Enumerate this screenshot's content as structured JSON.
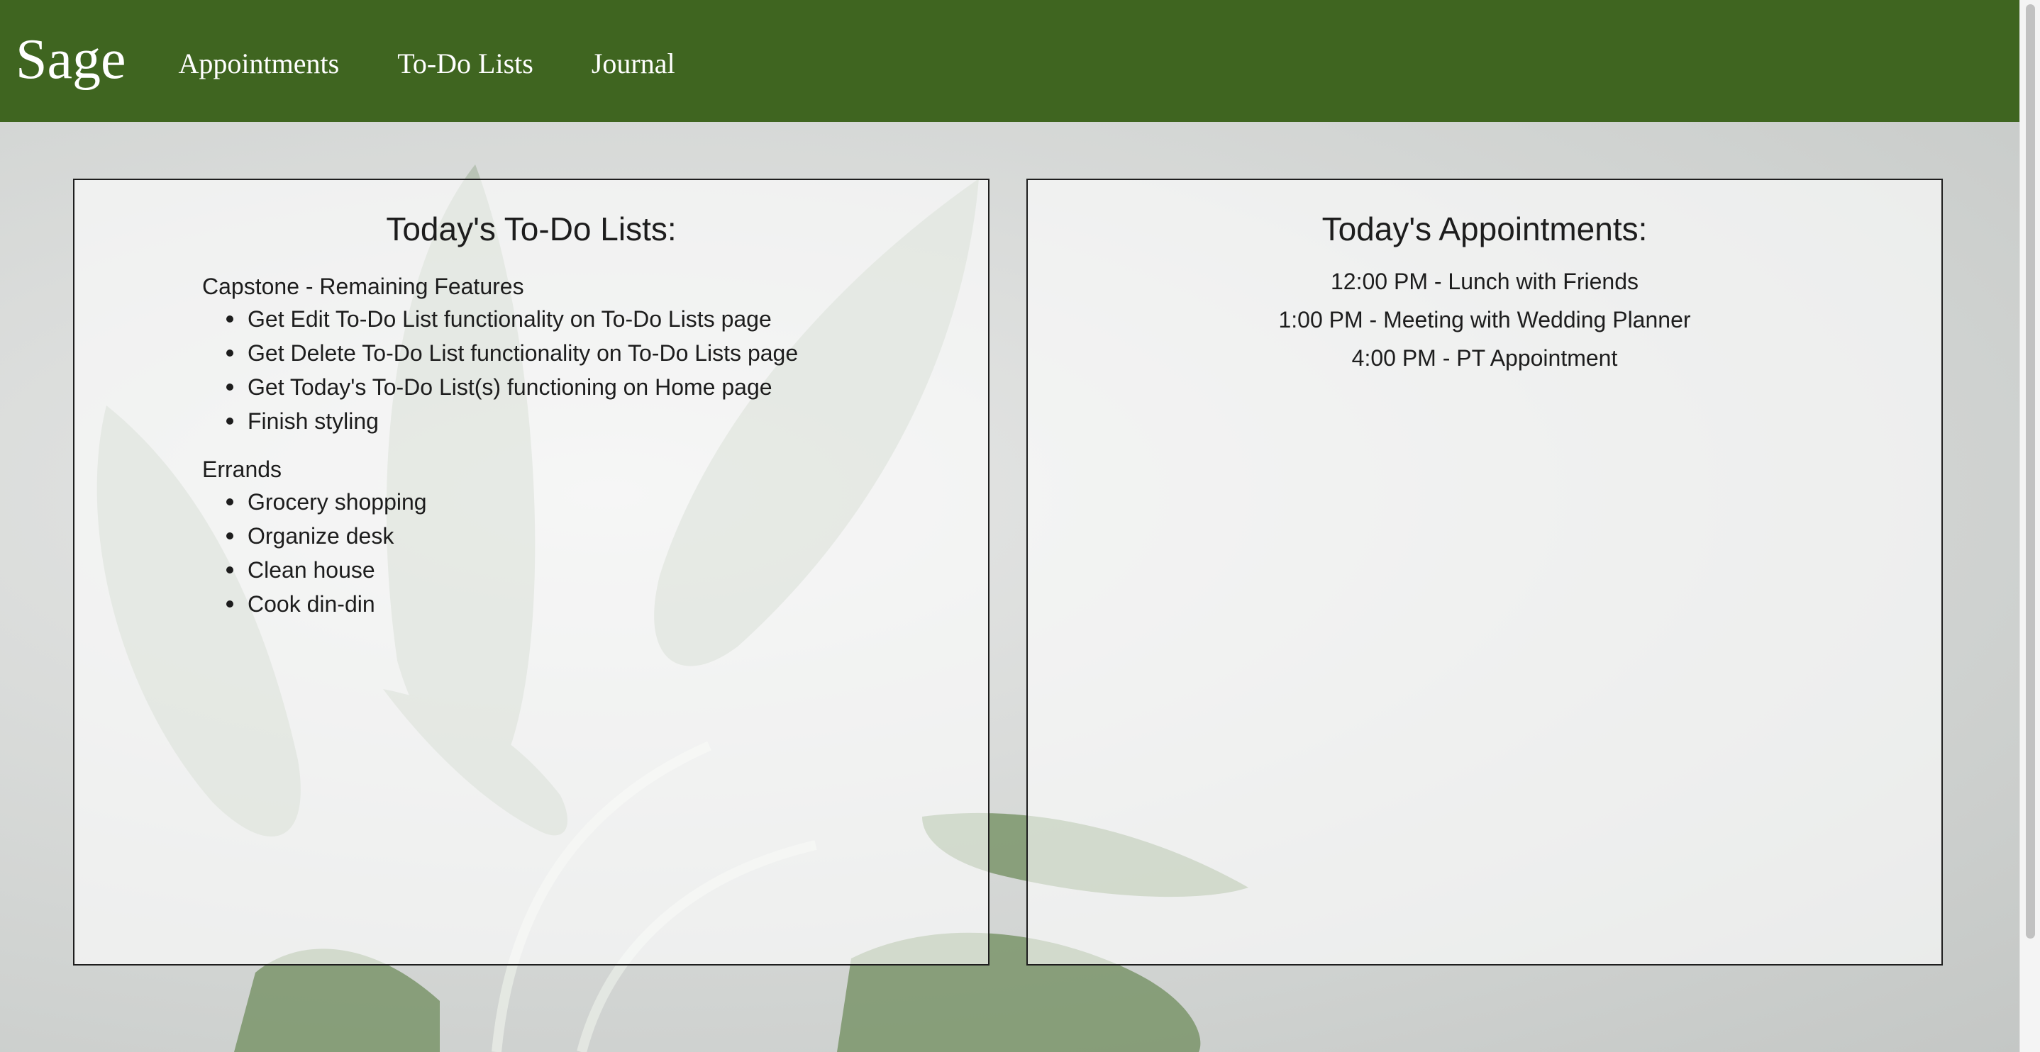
{
  "navbar": {
    "brand": "Sage",
    "links": [
      "Appointments",
      "To-Do Lists",
      "Journal"
    ],
    "color": "#3f6520"
  },
  "todo_panel": {
    "title": "Today's To-Do Lists:",
    "lists": [
      {
        "name": "Capstone - Remaining Features",
        "items": [
          "Get Edit To-Do List functionality on To-Do Lists page",
          "Get Delete To-Do List functionality on To-Do Lists page",
          "Get Today's To-Do List(s) functioning on Home page",
          "Finish styling"
        ]
      },
      {
        "name": "Errands",
        "items": [
          "Grocery shopping",
          "Organize desk",
          "Clean house",
          "Cook din-din"
        ]
      }
    ]
  },
  "appointments_panel": {
    "title": "Today's Appointments:",
    "items": [
      "12:00 PM - Lunch with Friends",
      "1:00 PM - Meeting with Wedding Planner",
      "4:00 PM - PT Appointment"
    ]
  }
}
